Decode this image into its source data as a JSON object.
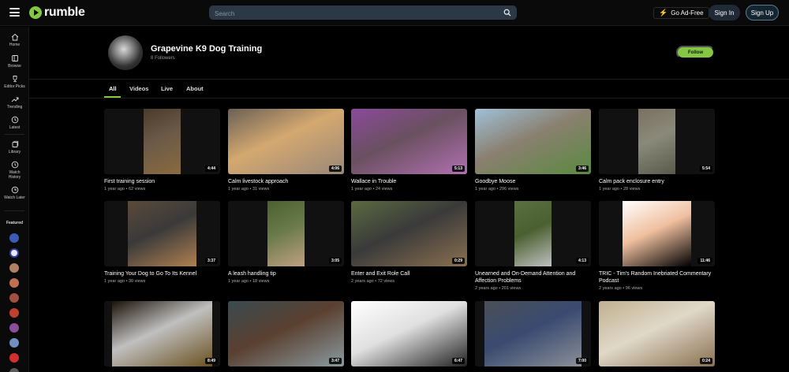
{
  "header": {
    "logo_text": "rumble",
    "search_placeholder": "Search",
    "go_adfree_label": "Go Ad-Free",
    "signin_label": "Sign In",
    "signup_label": "Sign Up"
  },
  "sidebar": {
    "items": [
      {
        "label": "Home",
        "icon": "home-icon"
      },
      {
        "label": "Browse",
        "icon": "browse-icon"
      },
      {
        "label": "Editor Picks",
        "icon": "trophy-icon"
      },
      {
        "label": "Trending",
        "icon": "trending-icon"
      },
      {
        "label": "Latest",
        "icon": "clock-icon"
      },
      {
        "label": "Library",
        "icon": "library-icon"
      },
      {
        "label": "Watch History",
        "icon": "history-icon"
      },
      {
        "label": "Watch Later",
        "icon": "watch-later-icon"
      }
    ],
    "featured_label": "Featured",
    "featured_colors": [
      "#3b5bb5",
      "#e8e8ff",
      "#b08060",
      "#c07050",
      "#a05040",
      "#c04030",
      "#8a4e9a",
      "#7090c0",
      "#d03030"
    ]
  },
  "channel": {
    "name": "Grapevine K9 Dog Training",
    "followers": "8 Followers",
    "follow_label": "Follow"
  },
  "tabs": [
    {
      "label": "All",
      "active": true
    },
    {
      "label": "Videos",
      "active": false
    },
    {
      "label": "Live",
      "active": false
    },
    {
      "label": "About",
      "active": false
    }
  ],
  "videos": [
    {
      "title": "First training session",
      "meta": "1 year ago • 62 views",
      "duration": "4:44",
      "colors": [
        "#4a3a2a",
        "#8a6a40",
        "#6b5a48"
      ]
    },
    {
      "title": "Calm livestock approach",
      "meta": "1 year ago • 31 views",
      "duration": "4:06",
      "colors": [
        "#6b6055",
        "#9a8878",
        "#d4a870"
      ]
    },
    {
      "title": "Wallace in Trouble",
      "meta": "1 year ago • 24 views",
      "duration": "5:13",
      "colors": [
        "#8a4a9a",
        "#b070b0",
        "#6a5060"
      ]
    },
    {
      "title": "Goodbye Moose",
      "meta": "1 year ago • 296 views",
      "duration": "3:46",
      "colors": [
        "#a0c0d8",
        "#5a8a40",
        "#8a8070"
      ]
    },
    {
      "title": "Calm pack enclosure entry",
      "meta": "1 year ago • 28 views",
      "duration": "5:54",
      "colors": [
        "#7a7060",
        "#5a5a4a",
        "#8a8a7a"
      ]
    },
    {
      "title": "Training Your Dog to Go To Its Kennel",
      "meta": "1 year ago • 30 views",
      "duration": "3:37",
      "colors": [
        "#5a4a3a",
        "#b08050",
        "#3a3a3a"
      ]
    },
    {
      "title": "A leash handling tip",
      "meta": "1 year ago • 18 views",
      "duration": "3:05",
      "colors": [
        "#4a6030",
        "#c0a080",
        "#6a7a4a"
      ]
    },
    {
      "title": "Enter and Exit Role Call",
      "meta": "2 years ago • 72 views",
      "duration": "0:29",
      "colors": [
        "#5a6a40",
        "#8a7050",
        "#3a3a3a"
      ]
    },
    {
      "title": "Unearned and On-Demand Attention and Affection Problems",
      "meta": "2 years ago • 201 views",
      "duration": "4:13",
      "colors": [
        "#5a7040",
        "#c0c0c0",
        "#4a6030"
      ]
    },
    {
      "title": "TRIC - Tim's Random Inebriated Commentary Podcast",
      "meta": "2 years ago • 96 views",
      "duration": "11:46",
      "colors": [
        "#ffffff",
        "#000000",
        "#f0c0a0"
      ]
    },
    {
      "title": "",
      "meta": "",
      "duration": "8:49",
      "colors": [
        "#1a1208",
        "#6a5020",
        "#c0c0c0"
      ]
    },
    {
      "title": "",
      "meta": "",
      "duration": "3:47",
      "colors": [
        "#3a4a50",
        "#8a9aa0",
        "#5a4030"
      ]
    },
    {
      "title": "",
      "meta": "",
      "duration": "6:47",
      "colors": [
        "#ffffff",
        "#222222",
        "#e0e0e0"
      ]
    },
    {
      "title": "",
      "meta": "",
      "duration": "7:00",
      "colors": [
        "#4a5058",
        "#8a9098",
        "#3a4a70"
      ]
    },
    {
      "title": "",
      "meta": "",
      "duration": "0:24",
      "colors": [
        "#c0b090",
        "#8a7050",
        "#e0d8c8"
      ]
    }
  ]
}
